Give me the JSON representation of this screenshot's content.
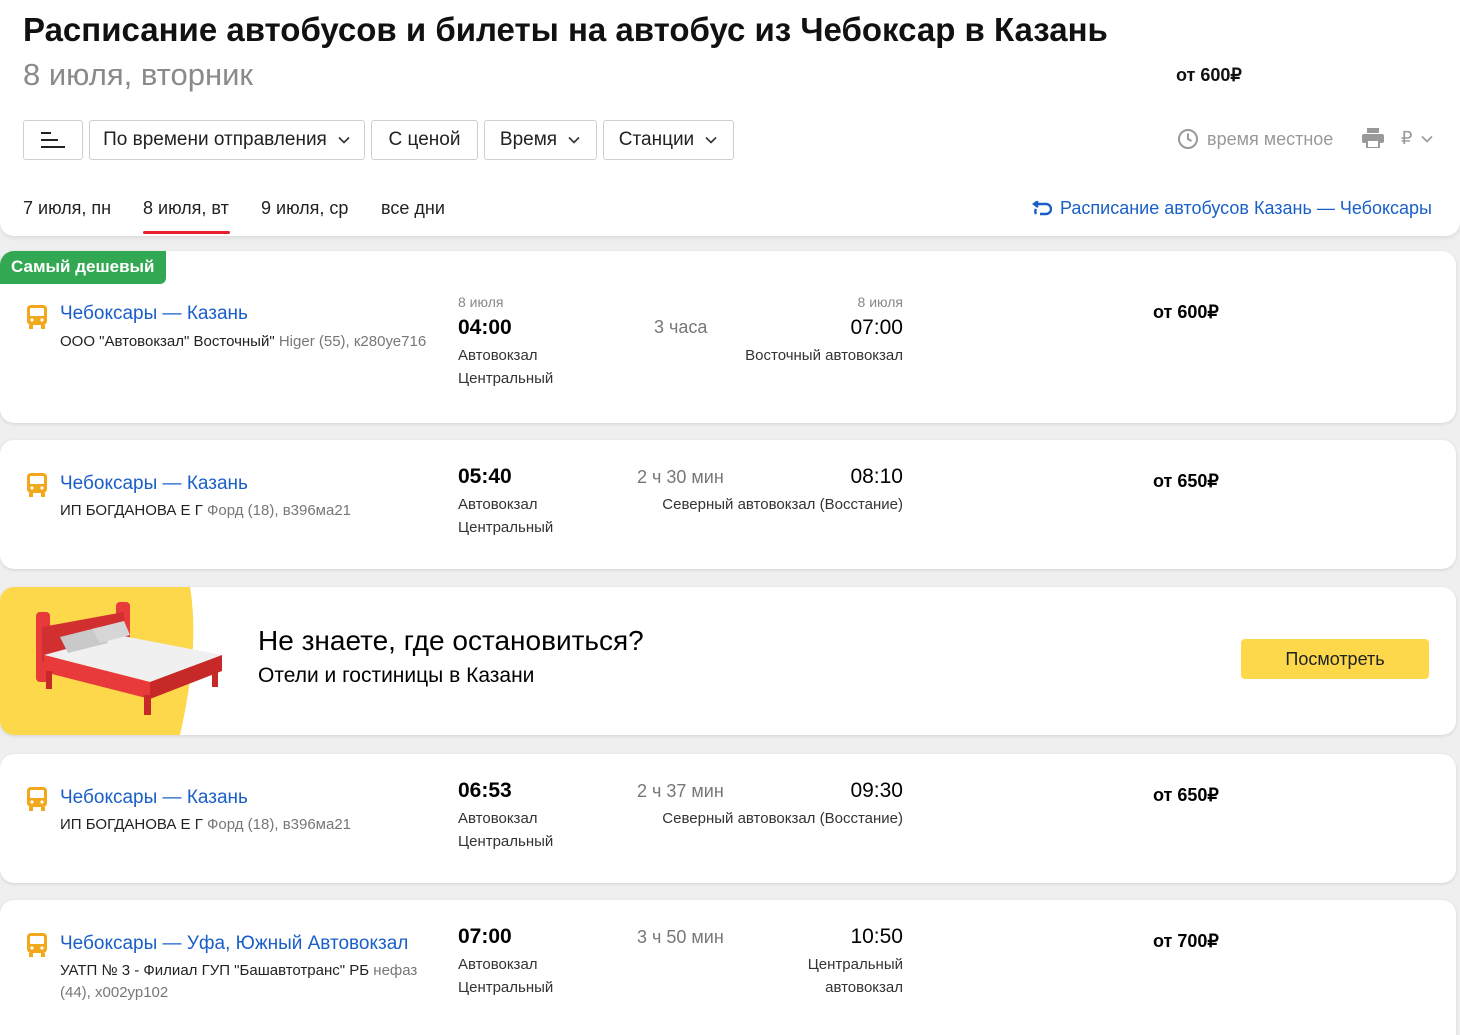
{
  "header": {
    "title": "Расписание автобусов и билеты на автобус из Чебоксар в Казань",
    "price_from": "от 600₽",
    "date": "8 июля, вторник"
  },
  "toolbar": {
    "sort_label": "По времени отправления",
    "price_toggle": "С ценой",
    "time_filter": "Время",
    "stations_filter": "Станции",
    "local_time": "время местное",
    "currency": "₽"
  },
  "dates": [
    "7 июля, пн",
    "8 июля, вт",
    "9 июля, ср",
    "все дни"
  ],
  "reverse_link": "Расписание автобусов Казань — Чебоксары",
  "badge": "Самый дешевый",
  "trips": [
    {
      "route": "Чебоксары — Казань",
      "carrier": "ООО \"Автовокзал\" Восточный\"",
      "bus": "Higer (55), к280уе716",
      "dep_date": "8 июля",
      "dep_time": "04:00",
      "dep_station": "Автовокзал Центральный",
      "duration": "3 часа",
      "arr_date": "8 июля",
      "arr_time": "07:00",
      "arr_station": "Восточный автовокзал",
      "price": "от 600₽"
    },
    {
      "route": "Чебоксары — Казань",
      "carrier": "ИП БОГДАНОВА Е Г",
      "bus": "Форд (18), в396ма21",
      "dep_time": "05:40",
      "dep_station": "Автовокзал Центральный",
      "duration": "2 ч 30 мин",
      "arr_time": "08:10",
      "arr_station": "Северный автовокзал (Восстание)",
      "price": "от 650₽"
    },
    {
      "route": "Чебоксары — Казань",
      "carrier": "ИП БОГДАНОВА Е Г",
      "bus": "Форд (18), в396ма21",
      "dep_time": "06:53",
      "dep_station": "Автовокзал Центральный",
      "duration": "2 ч 37 мин",
      "arr_time": "09:30",
      "arr_station": "Северный автовокзал (Восстание)",
      "price": "от 650₽"
    },
    {
      "route": "Чебоксары — Уфа, Южный Автовокзал",
      "carrier": "УАТП № 3 - Филиал ГУП \"Башавтотранс\" РБ",
      "bus": "нефаз (44), х002ур102",
      "dep_time": "07:00",
      "dep_station": "Автовокзал Центральный",
      "duration": "3 ч 50 мин",
      "arr_time": "10:50",
      "arr_station": "Центральный автовокзал",
      "price": "от 700₽"
    }
  ],
  "promo": {
    "title": "Не знаете, где остановиться?",
    "subtitle": "Отели и гостиницы в Казани",
    "button": "Посмотреть"
  },
  "colors": {
    "link": "#1a5fc8",
    "badge": "#33a853",
    "active_tab": "#e8212b",
    "bus_icon": "#f2a81b",
    "promo_yellow": "#fcd84a"
  }
}
